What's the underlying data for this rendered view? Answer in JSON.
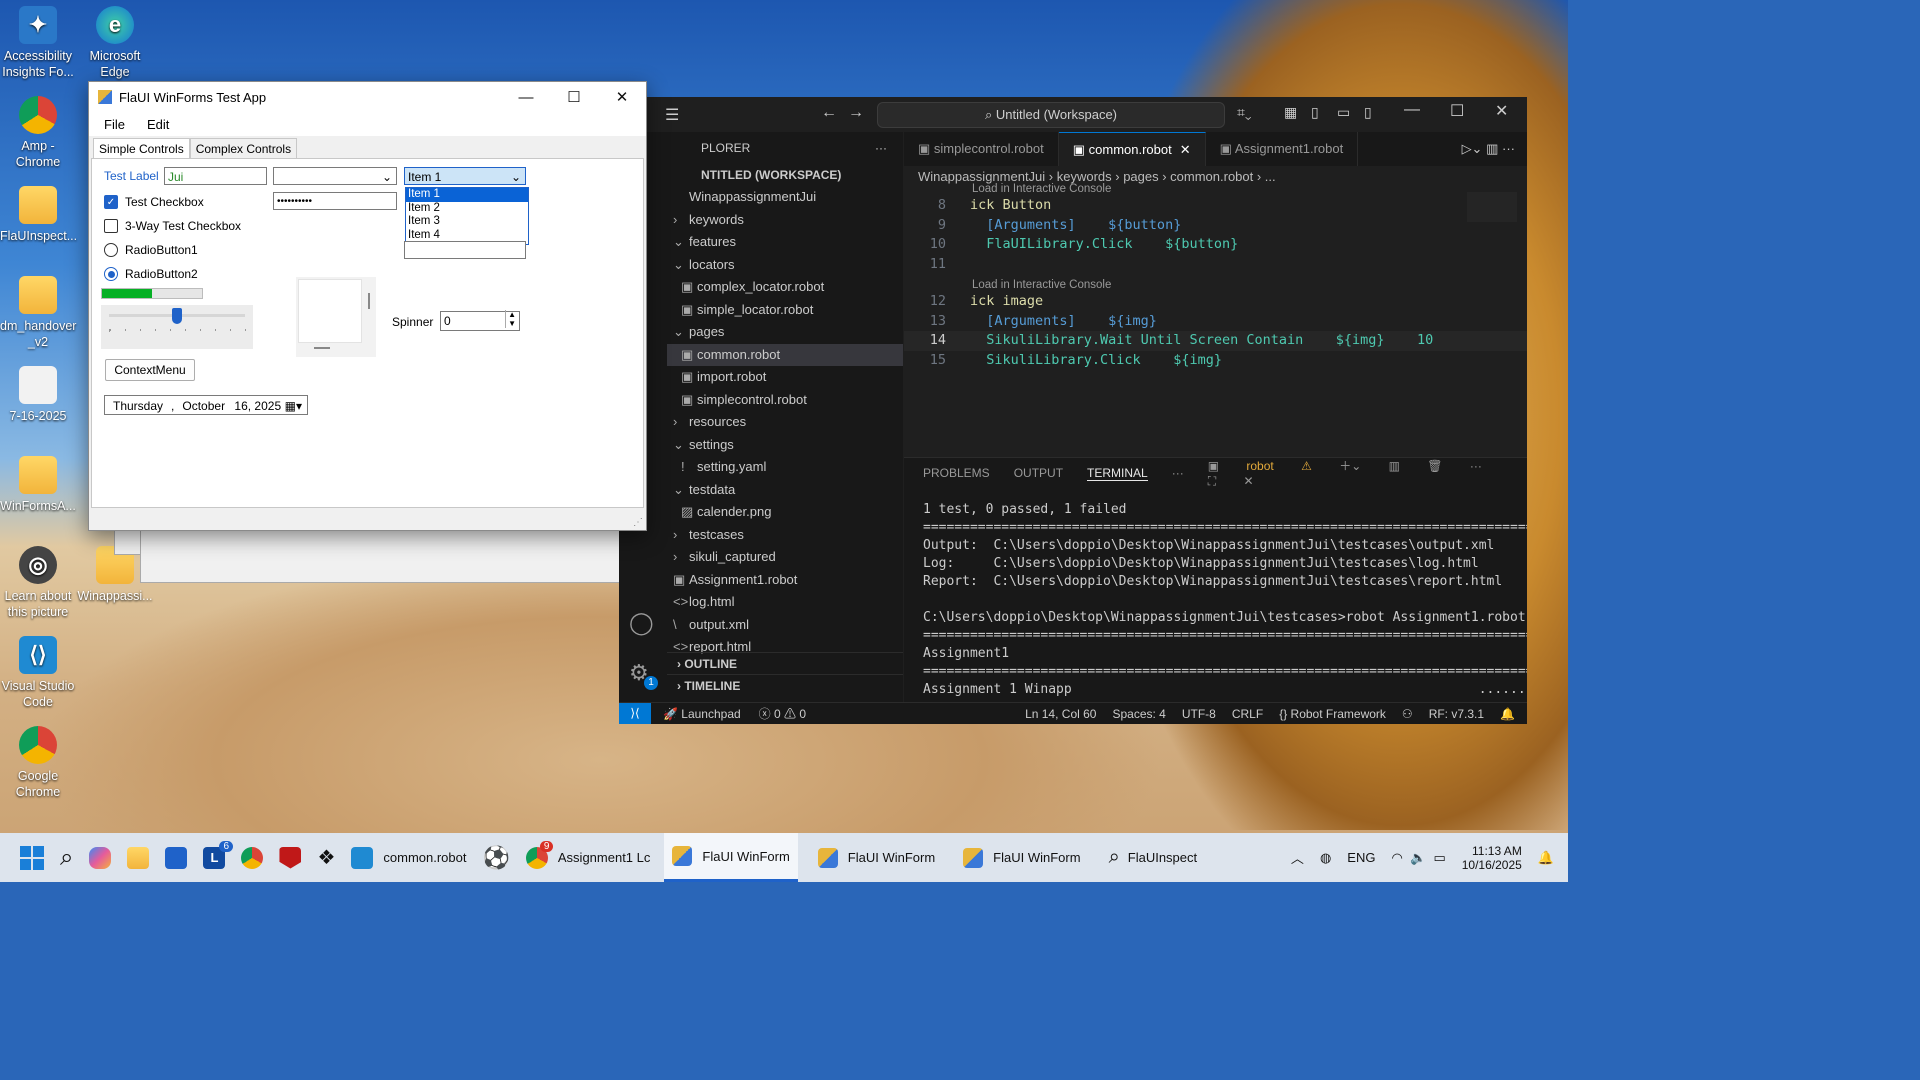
{
  "desktop": {
    "icons": [
      {
        "label": "Accessibility Insights Fo...",
        "icon": "accessibility-insights-icon"
      },
      {
        "label": "Microsoft Edge",
        "icon": "edge-icon"
      },
      {
        "label": "Amp - Chrome",
        "icon": "chrome-icon"
      },
      {
        "label": "FlaUInspect...",
        "icon": "folder-icon"
      },
      {
        "label": "dm_handover _v2",
        "icon": "folder-icon"
      },
      {
        "label": "7-16-2025",
        "icon": "file-icon"
      },
      {
        "label": "WinFormsA...",
        "icon": "folder-icon"
      },
      {
        "label": "Learn about this picture",
        "icon": "camera-icon"
      },
      {
        "label": "Winappassi...",
        "icon": "folder-icon"
      },
      {
        "label": "Visual Studio Code",
        "icon": "vscode-icon"
      },
      {
        "label": "Google Chrome",
        "icon": "chrome-icon"
      }
    ]
  },
  "winforms": {
    "title": "FlaUI WinForms Test App",
    "menu": [
      "File",
      "Edit"
    ],
    "tabs": [
      "Simple Controls",
      "Complex Controls"
    ],
    "test_label": "Test Label",
    "text_value": "Jui",
    "password_value": "••••••••••",
    "combo_selected": "Item 1",
    "combo_items": [
      "Item 1",
      "Item 2",
      "Item 3",
      "Item 4"
    ],
    "checkbox1": "Test Checkbox",
    "checkbox2": "3-Way Test Checkbox",
    "radio1": "RadioButton1",
    "radio2": "RadioButton2",
    "progress_fraction": 0.5,
    "slider_fraction": 0.5,
    "spinner_label": "Spinner",
    "spinner_value": "0",
    "context_button": "ContextMenu",
    "date_day": "Thursday",
    "date_comma": ",",
    "date_month": "October",
    "date_daynum": "16, 2025"
  },
  "vscode": {
    "search": "Untitled (Workspace)",
    "explorer_title": "PLORER",
    "workspace": "NTITLED (WORKSPACE)",
    "tree": [
      {
        "label": "WinappassignmentJui",
        "indent": 0,
        "twisty": ""
      },
      {
        "label": "keywords",
        "indent": 0,
        "twisty": "›"
      },
      {
        "label": "features",
        "indent": 0,
        "twisty": "⌄"
      },
      {
        "label": "locators",
        "indent": 0,
        "twisty": "⌄"
      },
      {
        "label": "complex_locator.robot",
        "indent": 1,
        "twisty": "▣"
      },
      {
        "label": "simple_locator.robot",
        "indent": 1,
        "twisty": "▣"
      },
      {
        "label": "pages",
        "indent": 0,
        "twisty": "⌄"
      },
      {
        "label": "common.robot",
        "indent": 1,
        "twisty": "▣",
        "selected": true
      },
      {
        "label": "import.robot",
        "indent": 1,
        "twisty": "▣"
      },
      {
        "label": "simplecontrol.robot",
        "indent": 1,
        "twisty": "▣"
      },
      {
        "label": "resources",
        "indent": 0,
        "twisty": "›"
      },
      {
        "label": "settings",
        "indent": 0,
        "twisty": "⌄"
      },
      {
        "label": "setting.yaml",
        "indent": 1,
        "twisty": "!"
      },
      {
        "label": "testdata",
        "indent": 0,
        "twisty": "⌄"
      },
      {
        "label": "calender.png",
        "indent": 1,
        "twisty": "▨"
      },
      {
        "label": "testcases",
        "indent": 0,
        "twisty": "›"
      },
      {
        "label": "sikuli_captured",
        "indent": 0,
        "twisty": "›"
      },
      {
        "label": "Assignment1.robot",
        "indent": 0,
        "twisty": "▣"
      },
      {
        "label": "log.html",
        "indent": 0,
        "twisty": "<>"
      },
      {
        "label": "output.xml",
        "indent": 0,
        "twisty": "\\"
      },
      {
        "label": "report.html",
        "indent": 0,
        "twisty": "<>"
      }
    ],
    "outline": "OUTLINE",
    "timeline": "TIMELINE",
    "editor_tabs": [
      "simplecontrol.robot",
      "common.robot",
      "Assignment1.robot"
    ],
    "breadcrumb": "WinappassignmentJui › keywords › pages › common.robot › ...",
    "codelens1": "Load in Interactive Console",
    "codelens2": "Load in Interactive Console",
    "lines": [
      {
        "n": "8",
        "t": "ick Button"
      },
      {
        "n": "9",
        "t": "  [Arguments]    ${button}"
      },
      {
        "n": "10",
        "t": "  FlaUILibrary.Click    ${button}"
      },
      {
        "n": "11",
        "t": ""
      },
      {
        "n": "12",
        "t": "ick image"
      },
      {
        "n": "13",
        "t": "  [Arguments]    ${img}"
      },
      {
        "n": "14",
        "t": "  SikuliLibrary.Wait Until Screen Contain    ${img}    10"
      },
      {
        "n": "15",
        "t": "  SikuliLibrary.Click    ${img}"
      }
    ],
    "panel_tabs": [
      "PROBLEMS",
      "OUTPUT",
      "TERMINAL"
    ],
    "terminal_profile": "robot",
    "terminal": [
      "1 test, 0 passed, 1 failed",
      "==============================================================================",
      "Output:  C:\\Users\\doppio\\Desktop\\WinappassignmentJui\\testcases\\output.xml",
      "Log:     C:\\Users\\doppio\\Desktop\\WinappassignmentJui\\testcases\\log.html",
      "Report:  C:\\Users\\doppio\\Desktop\\WinappassignmentJui\\testcases\\report.html",
      "",
      "C:\\Users\\doppio\\Desktop\\WinappassignmentJui\\testcases>robot Assignment1.robot",
      "==============================================================================",
      "Assignment1",
      "==============================================================================",
      "Assignment 1 Winapp                                                    ......."
    ],
    "status": {
      "launchpad": "Launchpad",
      "errors": "0",
      "warnings": "0",
      "position": "Ln 14, Col 60",
      "spaces": "Spaces: 4",
      "encoding": "UTF-8",
      "eol": "CRLF",
      "language": "Robot Framework",
      "rf": "RF: v7.3.1"
    },
    "settings_badge": "1"
  },
  "taskbar": {
    "apps": [
      {
        "label": "common.robot",
        "icon": "vscode-icon"
      },
      {
        "label": "Assignment1 Lc",
        "icon": "chrome-icon",
        "badge": "9"
      },
      {
        "label": "FlaUI WinForm",
        "icon": "winforms-icon"
      },
      {
        "label": "FlaUI WinForm",
        "icon": "winforms-icon"
      },
      {
        "label": "FlaUI WinForm",
        "icon": "winforms-icon"
      },
      {
        "label": "FlaUInspect",
        "icon": "search-icon"
      }
    ],
    "lang": "ENG",
    "time": "11:13 AM",
    "date": "10/16/2025",
    "l_badge": "6"
  }
}
